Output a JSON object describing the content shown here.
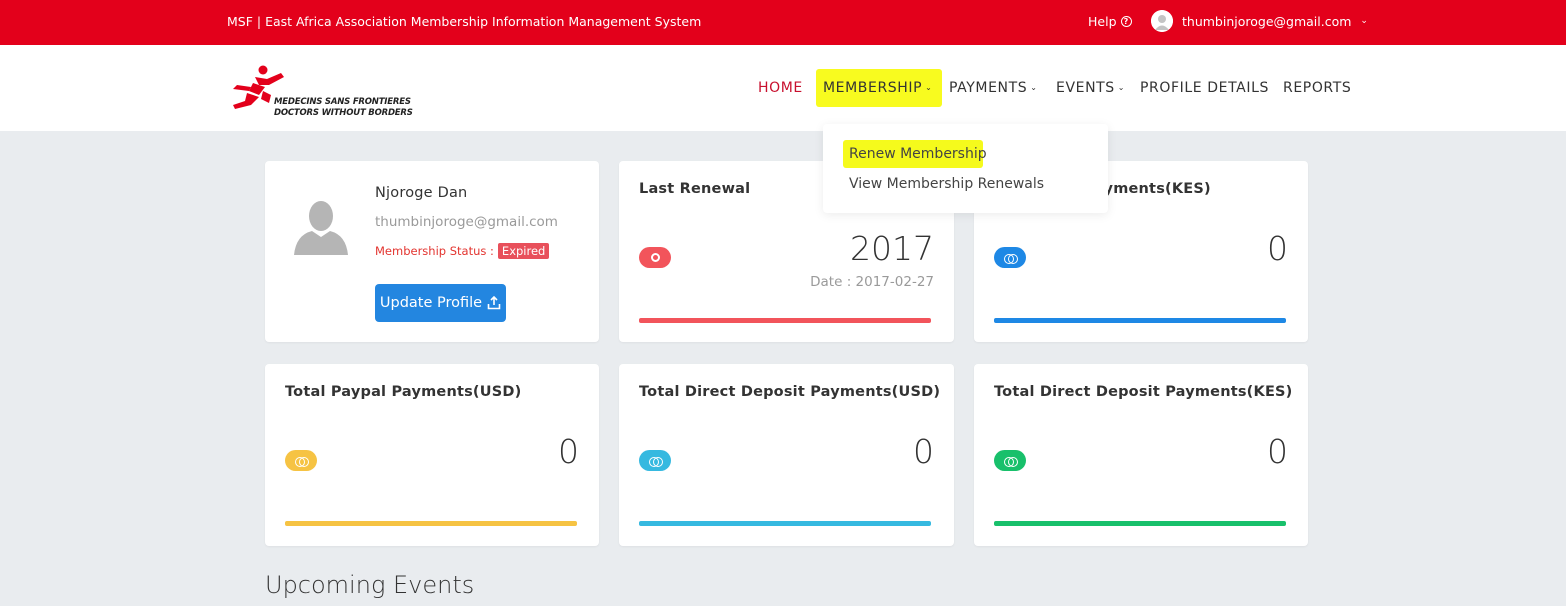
{
  "topbar": {
    "title": "MSF | East Africa Association Membership Information Management System",
    "help": "Help",
    "user_email": "thumbinjoroge@gmail.com"
  },
  "logo": {
    "line1": "MEDECINS SANS FRONTIERES",
    "line2": "DOCTORS WITHOUT BORDERS"
  },
  "nav": {
    "home": "HOME",
    "membership": "MEMBERSHIP",
    "payments": "PAYMENTS",
    "events": "EVENTS",
    "profile": "PROFILE DETAILS",
    "reports": "REPORTS"
  },
  "dropdown": {
    "renew": "Renew Membership",
    "view": "View Membership Renewals"
  },
  "profile": {
    "name": "Njoroge Dan",
    "email": "thumbinjoroge@gmail.com",
    "status_label": "Membership Status :",
    "status_value": "Expired",
    "update_button": "Update Profile"
  },
  "cards": {
    "renewal": {
      "title": "Last Renewal",
      "value": "2017",
      "sub": "Date : 2017-02-27"
    },
    "payments_kes": {
      "title": "ayments(KES)",
      "value": "0"
    },
    "paypal_usd": {
      "title": "Total Paypal Payments(USD)",
      "value": "0"
    },
    "deposit_usd": {
      "title": "Total Direct Deposit Payments(USD)",
      "value": "0"
    },
    "deposit_kes": {
      "title": "Total Direct Deposit Payments(KES)",
      "value": "0"
    }
  },
  "colors": {
    "brand_red": "#e3001b",
    "renewal": "#f2545b",
    "blue": "#1e88e5",
    "yellow": "#f6c343",
    "cyan": "#36b9e0",
    "green": "#18c06b",
    "highlight": "#f8fb1f"
  },
  "sections": {
    "upcoming": "Upcoming Events"
  }
}
